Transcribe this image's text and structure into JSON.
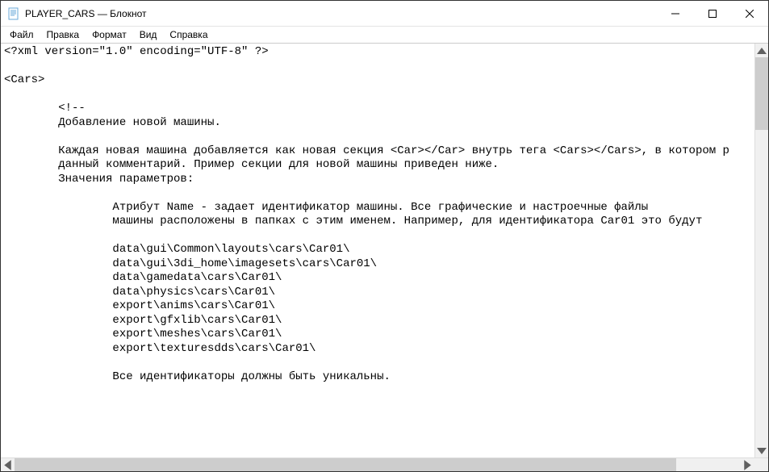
{
  "titlebar": {
    "title": "PLAYER_CARS — Блокнот"
  },
  "menu": {
    "file": "Файл",
    "edit": "Правка",
    "format": "Формат",
    "view": "Вид",
    "help": "Справка"
  },
  "editor": {
    "content": "<?xml version=\"1.0\" encoding=\"UTF-8\" ?>\n\n<Cars>\n\n        <!--\n        Добавление новой машины.\n\n        Каждая новая машина добавляется как новая секция <Car></Car> внутрь тега <Cars></Cars>, в котором р\n        данный комментарий. Пример секции для новой машины приведен ниже.\n        Значения параметров:\n\n                Атрибут Name - задает идентификатор машины. Все графические и настроечные файлы\n                машины расположены в папках с этим именем. Например, для идентификатора Car01 это будут\n\n                data\\gui\\Common\\layouts\\cars\\Car01\\\n                data\\gui\\3di_home\\imagesets\\cars\\Car01\\\n                data\\gamedata\\cars\\Car01\\\n                data\\physics\\cars\\Car01\\\n                export\\anims\\cars\\Car01\\\n                export\\gfxlib\\cars\\Car01\\\n                export\\meshes\\cars\\Car01\\\n                export\\texturesdds\\cars\\Car01\\\n\n                Все идентификаторы должны быть уникальны."
  }
}
